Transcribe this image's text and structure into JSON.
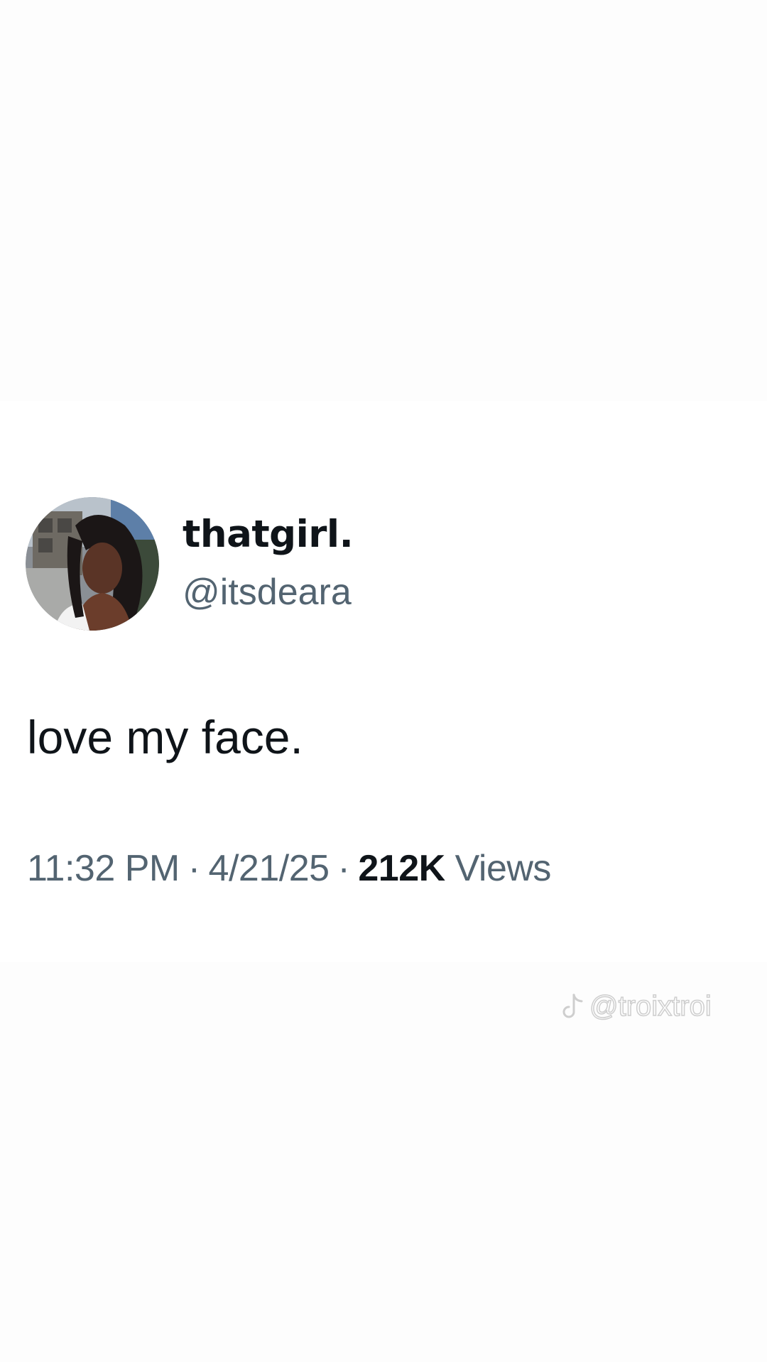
{
  "tweet": {
    "display_name": "thatgirl.",
    "handle": "@itsdeara",
    "text": "love my face.",
    "time": "11:32 PM",
    "separator": "·",
    "date": "4/21/25",
    "views_count": "212K",
    "views_label": "Views",
    "avatar": "profile-photo"
  },
  "watermark": {
    "icon": "tiktok-icon",
    "text": "@troixtroi"
  },
  "colors": {
    "primary_text": "#0f1419",
    "secondary_text": "#536471",
    "background": "#ffffff"
  }
}
